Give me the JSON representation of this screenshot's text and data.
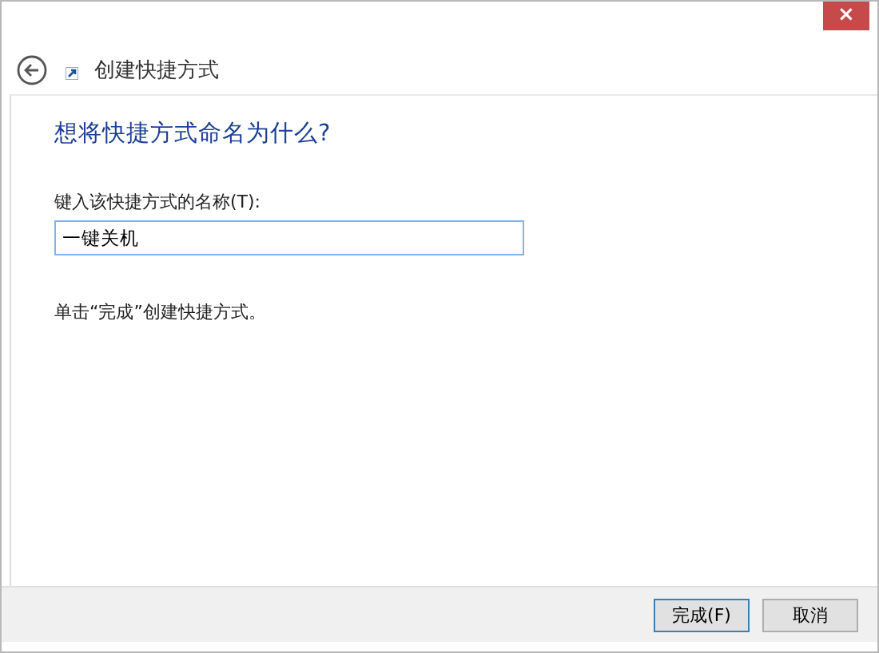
{
  "window": {
    "close_icon": "×"
  },
  "header": {
    "title": "创建快捷方式"
  },
  "content": {
    "heading": "想将快捷方式命名为什么?",
    "field_label": "键入该快捷方式的名称(T):",
    "field_value": "一键关机",
    "instruction": "单击“完成”创建快捷方式。"
  },
  "buttons": [
    {
      "label": "完成(F)",
      "kind": "default"
    },
    {
      "label": "取消",
      "kind": "normal"
    }
  ]
}
